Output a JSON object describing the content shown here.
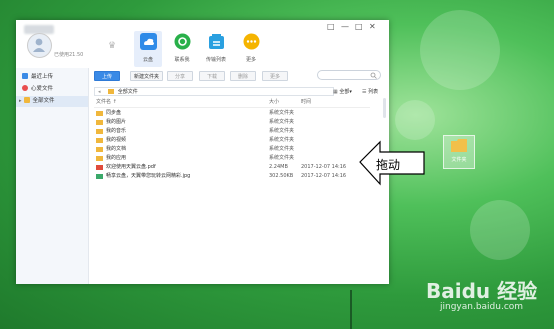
{
  "window": {
    "controls": [
      "□",
      "—",
      "□",
      "✕"
    ]
  },
  "user": {
    "vip_label": "已使用21.50"
  },
  "nav": {
    "items": [
      {
        "label": "云盘",
        "color": "#2f8be8",
        "icon": "cloud-icon"
      },
      {
        "label": "联系我",
        "color": "#29b04a",
        "icon": "contact-icon"
      },
      {
        "label": "传输列表",
        "color": "#2aa0e0",
        "icon": "transfer-icon"
      },
      {
        "label": "更多",
        "color": "#f5b400",
        "icon": "more-icon"
      }
    ]
  },
  "sidebar": {
    "items": [
      {
        "label": "最近上传",
        "color": "#3a8ae6"
      },
      {
        "label": "心爱文件",
        "color": "#e94e4e"
      },
      {
        "label": "全部文件",
        "color": "#f0b73c"
      }
    ]
  },
  "toolbar": {
    "upload": "上传",
    "new_folder": "新建文件夹",
    "share": "分享",
    "download": "下载",
    "delete": "删除",
    "more": "更多"
  },
  "view": {
    "all_label": "全部",
    "list_label": "列表"
  },
  "path": {
    "label": "全部文件"
  },
  "columns": {
    "name": "文件名 ↑",
    "size": "大小",
    "time": "时间"
  },
  "files": [
    {
      "name": "同步盘",
      "type": "folder",
      "size": "系统文件夹",
      "time": ""
    },
    {
      "name": "我的图片",
      "type": "folder",
      "size": "系统文件夹",
      "time": ""
    },
    {
      "name": "我的音乐",
      "type": "folder",
      "size": "系统文件夹",
      "time": ""
    },
    {
      "name": "我的视频",
      "type": "folder",
      "size": "系统文件夹",
      "time": ""
    },
    {
      "name": "我的文档",
      "type": "folder",
      "size": "系统文件夹",
      "time": ""
    },
    {
      "name": "我的应用",
      "type": "folder",
      "size": "系统文件夹",
      "time": ""
    },
    {
      "name": "欢迎使用天翼云盘.pdf",
      "type": "pdf",
      "size": "2.24MB",
      "time": "2017-12-07 14:16"
    },
    {
      "name": "畅享云盘，天翼带您玩转云网精彩.jpg",
      "type": "jpg",
      "size": "302.50KB",
      "time": "2017-12-07 14:16"
    }
  ],
  "callout": {
    "text": "拖动"
  },
  "desktop": {
    "icon_label": "文件夹"
  },
  "watermark": {
    "brand": "Baidu 经验",
    "url": "jingyan.baidu.com"
  }
}
